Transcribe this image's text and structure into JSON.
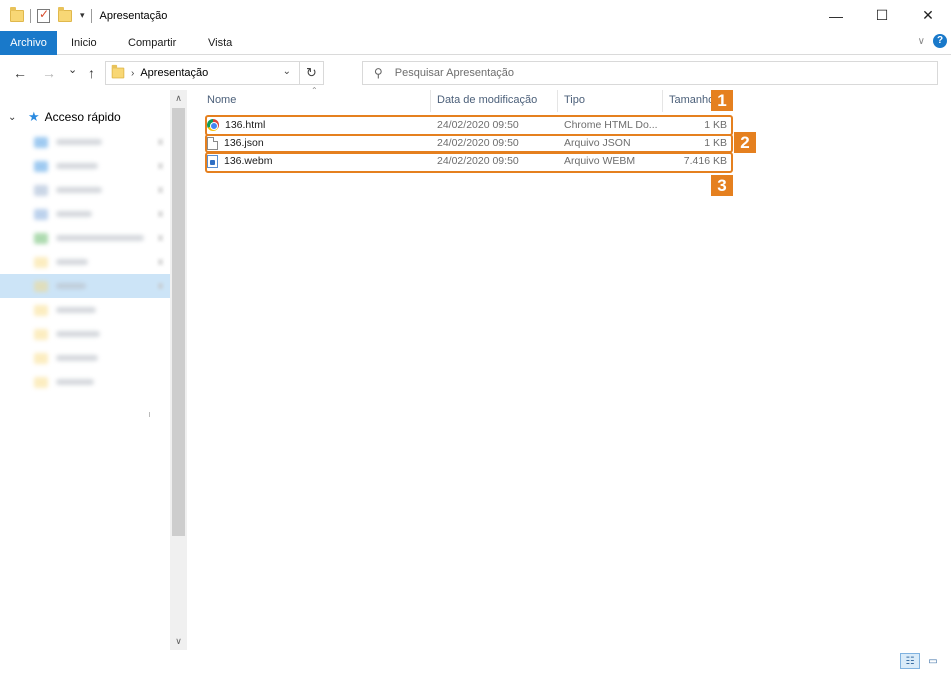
{
  "window": {
    "title": "Apresentação",
    "minimize_glyph": "—",
    "maximize_glyph": "☐",
    "close_glyph": "✕"
  },
  "ribbon": {
    "tabs": [
      "Archivo",
      "Inicio",
      "Compartir",
      "Vista"
    ],
    "help_glyph": "?",
    "expand_glyph": "∨"
  },
  "navbar": {
    "back_glyph": "←",
    "forward_glyph": "→",
    "recent_glyph": "⌄",
    "up_glyph": "↑",
    "breadcrumb": [
      "Apresentação"
    ],
    "crumb_separator": "›",
    "dropdown_glyph": "⌄",
    "refresh_glyph": "↻"
  },
  "search": {
    "placeholder": "Pesquisar Apresentação",
    "icon_glyph": "⚲"
  },
  "navpane": {
    "quick_access_label": "Acceso rápido",
    "expand_glyph": "⌄",
    "star_glyph": "★"
  },
  "columns": {
    "name": "Nome",
    "date": "Data de modificação",
    "type": "Tipo",
    "size": "Tamanho"
  },
  "files": [
    {
      "name": "136.html",
      "date": "24/02/2020 09:50",
      "type": "Chrome HTML Do...",
      "size": "1 KB",
      "icon": "chrome-icon"
    },
    {
      "name": "136.json",
      "date": "24/02/2020 09:50",
      "type": "Arquivo JSON",
      "size": "1 KB",
      "icon": "document-icon"
    },
    {
      "name": "136.webm",
      "date": "24/02/2020 09:50",
      "type": "Arquivo WEBM",
      "size": "7.416 KB",
      "icon": "media-file-icon"
    }
  ],
  "callouts": [
    "1",
    "2",
    "3"
  ],
  "colors": {
    "accent": "#1979ca",
    "callout": "#e5801f",
    "selection": "#cce4f7"
  },
  "scroll": {
    "up_glyph": "∧",
    "down_glyph": "∨"
  },
  "view_buttons": {
    "details_glyph": "☷",
    "large_icons_glyph": "▭"
  }
}
